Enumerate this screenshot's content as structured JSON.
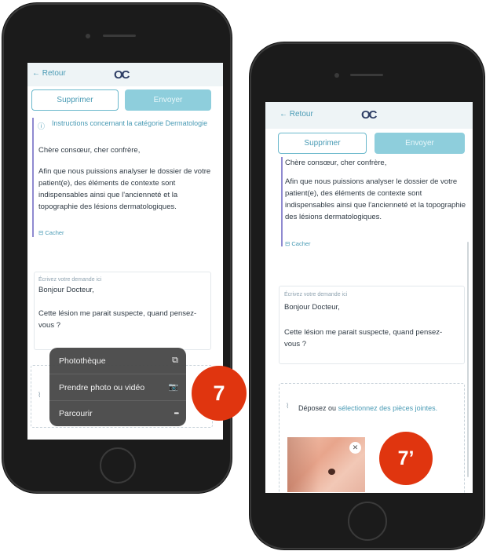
{
  "phone_left": {
    "topbar": {
      "back_label": "← Retour",
      "logo": "OC"
    },
    "buttons": {
      "delete": "Supprimer",
      "send": "Envoyer"
    },
    "instructions": {
      "title": "Instructions concernant la catégorie Dermatologie",
      "greeting": "Chère consœur, cher confrère,",
      "body": "Afin que nous puissions analyser le dossier de votre patient(e), des éléments de contexte sont indispensables ainsi que l'ancienneté et la topographie des lésions dermatologiques.",
      "hide": "Cacher"
    },
    "request": {
      "placeholder": "Écrivez votre demande ici",
      "line1": "Bonjour Docteur,",
      "line2": "Cette lésion me parait suspecte, quand pensez-vous ?"
    },
    "menu": [
      {
        "label": "Photothèque",
        "icon": "photo-library-icon",
        "glyph": "⧉"
      },
      {
        "label": "Prendre photo ou vidéo",
        "icon": "camera-icon",
        "glyph": "📷"
      },
      {
        "label": "Parcourir",
        "icon": "more-icon",
        "glyph": "•••"
      }
    ],
    "badge": "7"
  },
  "phone_right": {
    "topbar": {
      "back_label": "← Retour",
      "logo": "OC"
    },
    "buttons": {
      "delete": "Supprimer",
      "send": "Envoyer"
    },
    "instructions": {
      "greeting": "Chère consœur, cher confrère,",
      "body": "Afin que nous puissions analyser le dossier de votre patient(e), des éléments de contexte sont indispensables ainsi que l'ancienneté et la topographie des lésions dermatologiques.",
      "hide": "Cacher"
    },
    "request": {
      "placeholder": "Écrivez votre demande ici",
      "line1": "Bonjour Docteur,",
      "line2": "Cette lésion me parait suspecte, quand pensez-vous ?"
    },
    "attach": {
      "prefix": "Déposez ou",
      "link": "sélectionnez des pièces jointes."
    },
    "badge": "7’"
  },
  "colors": {
    "accent": "#4a9bb5",
    "button_fill": "#8ecedc",
    "badge": "#e0350f",
    "menu_bg": "#4b4b4b"
  }
}
